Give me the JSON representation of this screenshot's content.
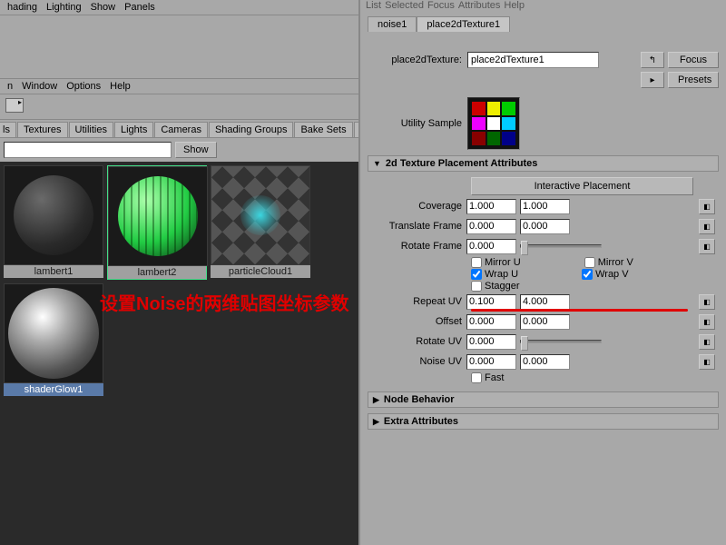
{
  "left": {
    "top_menu": [
      "hading",
      "Lighting",
      "Show",
      "Panels"
    ],
    "panel_menu": [
      "n",
      "Window",
      "Options",
      "Help"
    ],
    "tabs": [
      "ls",
      "Textures",
      "Utilities",
      "Lights",
      "Cameras",
      "Shading Groups",
      "Bake Sets",
      "F"
    ],
    "show_label": "Show",
    "thumbs": [
      {
        "name": "lambert1",
        "selected": false
      },
      {
        "name": "lambert2",
        "selected": true
      },
      {
        "name": "particleCloud1",
        "selected": false
      },
      {
        "name": "shaderGlow1",
        "selected_label": true
      }
    ]
  },
  "annotation": "设置Noise的两维贴图坐标参数",
  "right": {
    "top_menu": [
      "List",
      "Selected",
      "Focus",
      "Attributes",
      "Help"
    ],
    "tabs": [
      "noise1",
      "place2dTexture1"
    ],
    "active_tab": 1,
    "node_label": "place2dTexture:",
    "node_name": "place2dTexture1",
    "focus_btn": "Focus",
    "presets_btn": "Presets",
    "sample_label": "Utility Sample",
    "sections": {
      "tex2d": {
        "title": "2d Texture Placement Attributes",
        "interactive_btn": "Interactive Placement",
        "coverage": {
          "label": "Coverage",
          "u": "1.000",
          "v": "1.000"
        },
        "translateFrame": {
          "label": "Translate Frame",
          "u": "0.000",
          "v": "0.000"
        },
        "rotateFrame": {
          "label": "Rotate Frame",
          "val": "0.000"
        },
        "mirrorU": {
          "label": "Mirror U",
          "checked": false
        },
        "mirrorV": {
          "label": "Mirror V",
          "checked": false
        },
        "wrapU": {
          "label": "Wrap U",
          "checked": true
        },
        "wrapV": {
          "label": "Wrap V",
          "checked": true
        },
        "stagger": {
          "label": "Stagger",
          "checked": false
        },
        "repeatUV": {
          "label": "Repeat UV",
          "u": "0.100",
          "v": "4.000"
        },
        "offset": {
          "label": "Offset",
          "u": "0.000",
          "v": "0.000"
        },
        "rotateUV": {
          "label": "Rotate UV",
          "val": "0.000"
        },
        "noiseUV": {
          "label": "Noise UV",
          "u": "0.000",
          "v": "0.000"
        },
        "fast": {
          "label": "Fast",
          "checked": false
        }
      },
      "nodeBehavior": "Node Behavior",
      "extra": "Extra Attributes"
    }
  }
}
